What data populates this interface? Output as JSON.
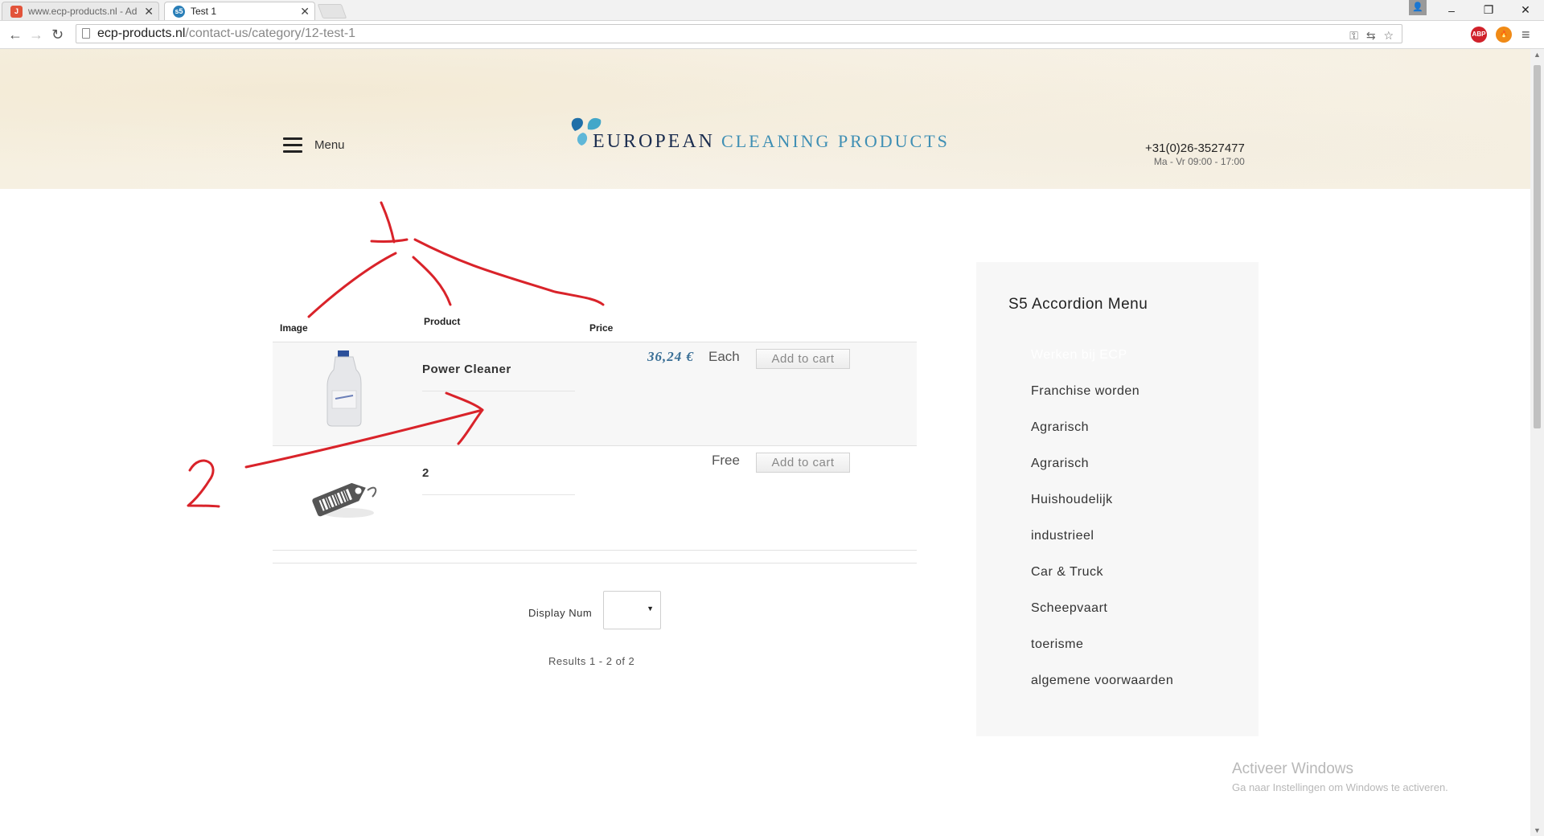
{
  "browser": {
    "tabs": [
      {
        "title": "www.ecp-products.nl - Ad",
        "favicon": "joomla-icon",
        "active": false
      },
      {
        "title": "Test 1",
        "favicon": "s5-icon",
        "active": true
      }
    ],
    "url_host": "ecp-products.nl",
    "url_path": "/contact-us/category/12-test-1"
  },
  "header": {
    "menu_label": "Menu",
    "logo_word1": "EUROPEAN",
    "logo_word2": "CLEANING PRODUCTS",
    "phone": "+31(0)26-3527477",
    "hours": "Ma - Vr  09:00 - 17:00"
  },
  "table": {
    "columns": [
      "Image",
      "Product",
      "Price"
    ],
    "rows": [
      {
        "name": "Power Cleaner",
        "price": "36,24 €",
        "unit": "Each",
        "button": "Add to cart",
        "image_icon": "bottle-icon"
      },
      {
        "name": "2",
        "price": "Free",
        "unit": "",
        "button": "Add to cart",
        "image_icon": "price-tag-icon"
      }
    ]
  },
  "pagination": {
    "display_label": "Display Num",
    "results": "Results 1 - 2 of 2"
  },
  "sidebar": {
    "title": "S5 Accordion Menu",
    "items": [
      "Werken bij ECP",
      "Franchise worden",
      "Agrarisch",
      "Agrarisch",
      "Huishoudelijk",
      "industrieel",
      "Car & Truck",
      "Scheepvaart",
      "toerisme",
      "algemene voorwaarden"
    ]
  },
  "annotations": {
    "label1": "1",
    "label2": "2"
  },
  "windows_watermark": {
    "line1": "Activeer Windows",
    "line2": "Ga naar Instellingen om Windows te activeren."
  },
  "colors": {
    "annotation": "#d9232a",
    "price": "#3a6f96",
    "sidebar_bg": "#f7f7f7"
  }
}
